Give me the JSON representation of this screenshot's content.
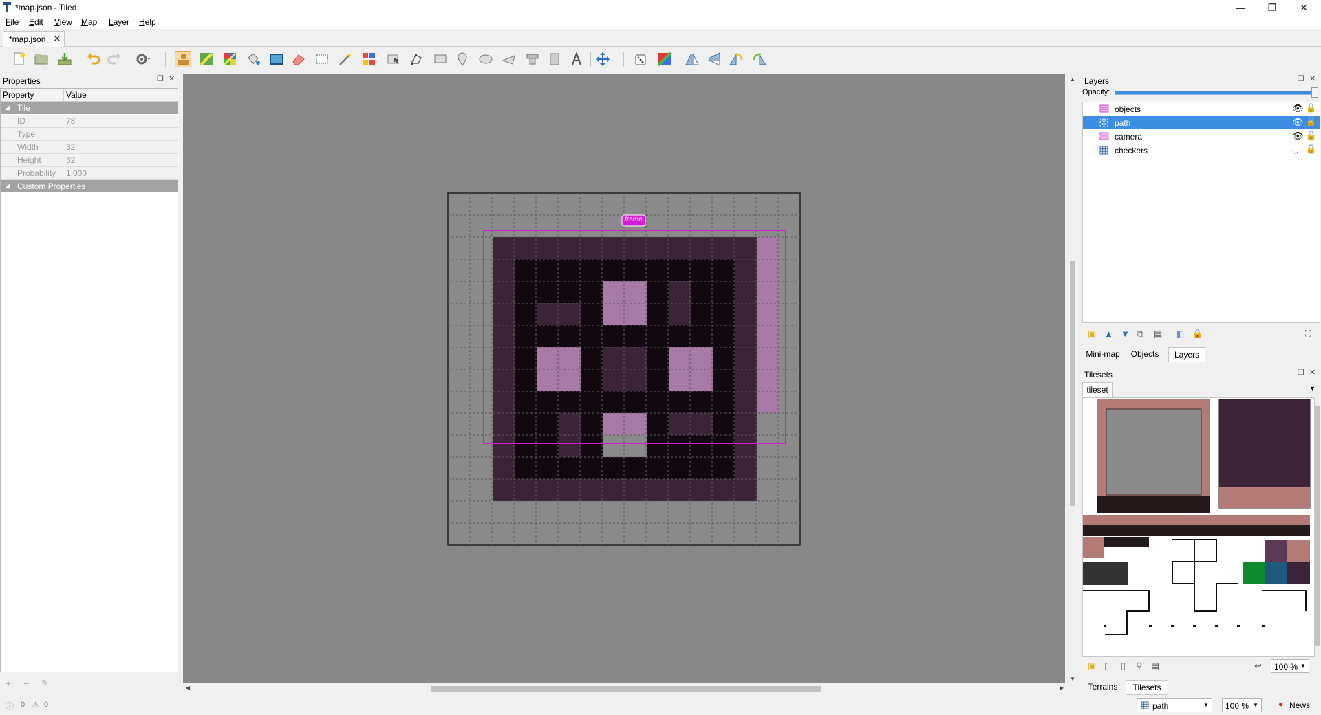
{
  "window": {
    "title": "*map.json - Tiled",
    "minimize": "—",
    "maximize": "❐",
    "close": "✕"
  },
  "menu": [
    {
      "label": "File",
      "key": "F",
      "rest": "ile"
    },
    {
      "label": "Edit",
      "key": "E",
      "rest": "dit"
    },
    {
      "label": "View",
      "key": "V",
      "rest": "iew"
    },
    {
      "label": "Map",
      "key": "M",
      "rest": "ap"
    },
    {
      "label": "Layer",
      "key": "L",
      "rest": "ayer"
    },
    {
      "label": "Help",
      "key": "H",
      "rest": "elp"
    }
  ],
  "document_tab": {
    "label": "*map.json",
    "close": "✕"
  },
  "toolbar": {
    "icons": [
      "new-map-icon",
      "open-icon",
      "save-icon",
      "undo-icon",
      "redo-icon",
      "commands-icon",
      "stamp-brush-icon",
      "terrain-brush-icon",
      "wang-brush-icon",
      "bucket-fill-icon",
      "shape-fill-icon",
      "eraser-icon",
      "rect-select-icon",
      "magic-wand-icon",
      "select-same-tile-icon",
      "select-objects-icon",
      "edit-polygons-icon",
      "insert-rectangle-icon",
      "insert-point-icon",
      "insert-ellipse-icon",
      "insert-polygon-icon",
      "insert-tile-icon",
      "insert-template-icon",
      "insert-text-icon",
      "move-icon",
      "random-mode-icon",
      "wang-fill-icon",
      "flip-horizontal-icon",
      "flip-vertical-icon",
      "rotate-left-icon",
      "rotate-right-icon"
    ],
    "active": "stamp-brush-icon"
  },
  "properties": {
    "title": "Properties",
    "col_property": "Property",
    "col_value": "Value",
    "group_tile": "Tile",
    "rows": [
      {
        "name": "ID",
        "value": "78"
      },
      {
        "name": "Type",
        "value": ""
      },
      {
        "name": "Width",
        "value": "32"
      },
      {
        "name": "Height",
        "value": "32"
      },
      {
        "name": "Probability",
        "value": "1,000"
      }
    ],
    "group_custom": "Custom Properties"
  },
  "map": {
    "object_label": "frame",
    "colors": {
      "background": "#888888",
      "outer": "#3b2438",
      "inner": "#120910",
      "pink": "#a77ba6",
      "dark_tile": "#3b2438",
      "grid": "#5a5a5a",
      "object_outline": "#d020d0",
      "selection": "#c9a2c8"
    }
  },
  "layers": {
    "title": "Layers",
    "opacity_label": "Opacity:",
    "opacity": 1.0,
    "items": [
      {
        "name": "objects",
        "type": "object",
        "visible": true,
        "selected": false
      },
      {
        "name": "path",
        "type": "tile",
        "visible": true,
        "selected": true
      },
      {
        "name": "camera",
        "type": "object",
        "visible": true,
        "selected": false
      },
      {
        "name": "checkers",
        "type": "tile",
        "visible": false,
        "selected": false
      }
    ],
    "tabs": [
      "Mini-map",
      "Objects",
      "Layers"
    ],
    "active_tab": "Layers"
  },
  "tilesets": {
    "title": "Tilesets",
    "tab": "tileset",
    "zoom": "100 %",
    "bottom_tabs": [
      "Terrains",
      "Tilesets"
    ],
    "active_tab": "Tilesets"
  },
  "status": {
    "errors": "0",
    "warnings": "0",
    "layer": "path",
    "zoom": "100 %",
    "news": "News"
  }
}
